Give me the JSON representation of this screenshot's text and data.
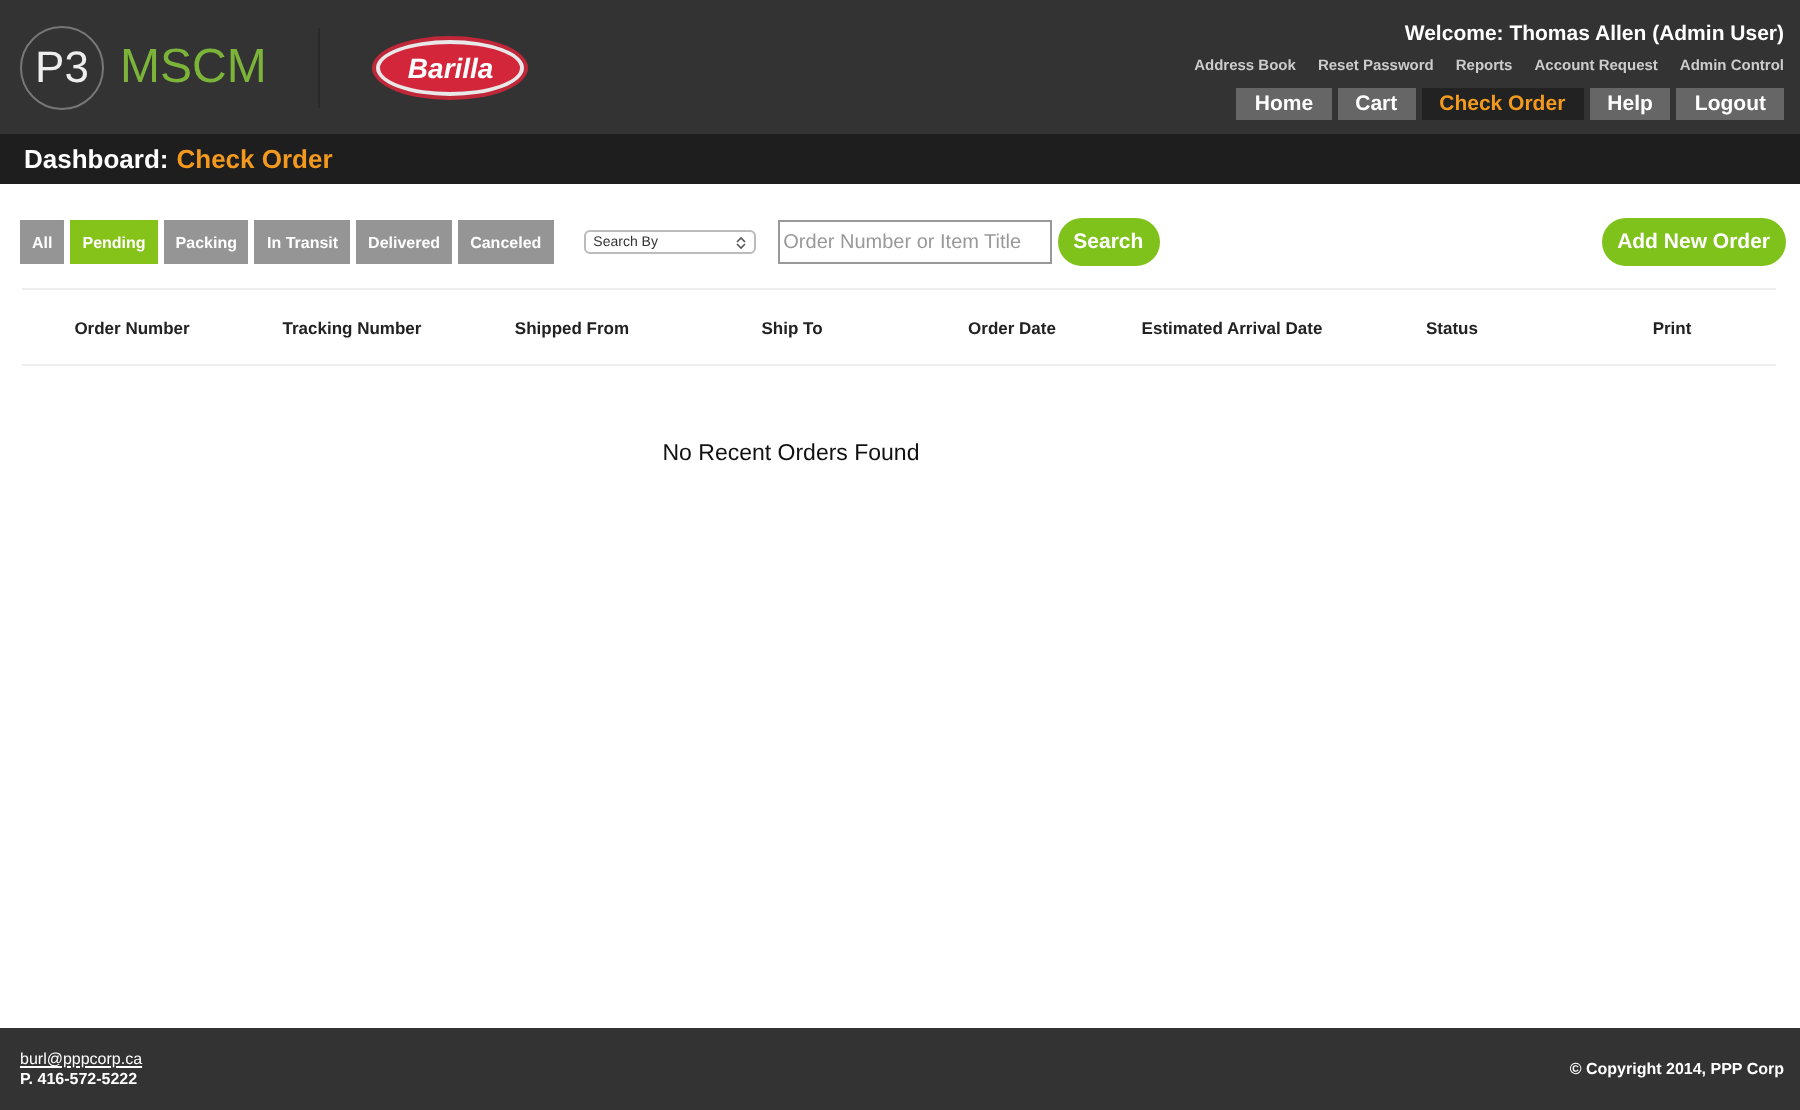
{
  "header": {
    "logo_mark": "P3",
    "app_name": "MSCM",
    "brand_logo": "Barilla",
    "welcome": "Welcome: Thomas Allen (Admin User)",
    "utility_links": [
      "Address Book",
      "Reset Password",
      "Reports",
      "Account Request",
      "Admin Control"
    ],
    "nav": [
      {
        "label": "Home",
        "selected": false
      },
      {
        "label": "Cart",
        "selected": false
      },
      {
        "label": "Check Order",
        "selected": true
      },
      {
        "label": "Help",
        "selected": false
      },
      {
        "label": "Logout",
        "selected": false
      }
    ]
  },
  "breadcrumb": {
    "prefix": "Dashboard:",
    "current": "Check Order"
  },
  "filters": [
    {
      "label": "All",
      "selected": false
    },
    {
      "label": "Pending",
      "selected": true
    },
    {
      "label": "Packing",
      "selected": false
    },
    {
      "label": "In Transit",
      "selected": false
    },
    {
      "label": "Delivered",
      "selected": false
    },
    {
      "label": "Canceled",
      "selected": false
    }
  ],
  "search": {
    "select": "Search By",
    "placeholder": "Order Number or Item Title",
    "button": "Search"
  },
  "add_button": "Add New Order",
  "table": {
    "columns": [
      "Order Number",
      "Tracking Number",
      "Shipped From",
      "Ship To",
      "Order Date",
      "Estimated Arrival Date",
      "Status",
      "Print"
    ],
    "empty_message": "No Recent Orders Found"
  },
  "footer": {
    "email": "burl@pppcorp.ca",
    "phone": "P. 416-572-5222",
    "copyright": "© Copyright 2014, PPP Corp"
  }
}
